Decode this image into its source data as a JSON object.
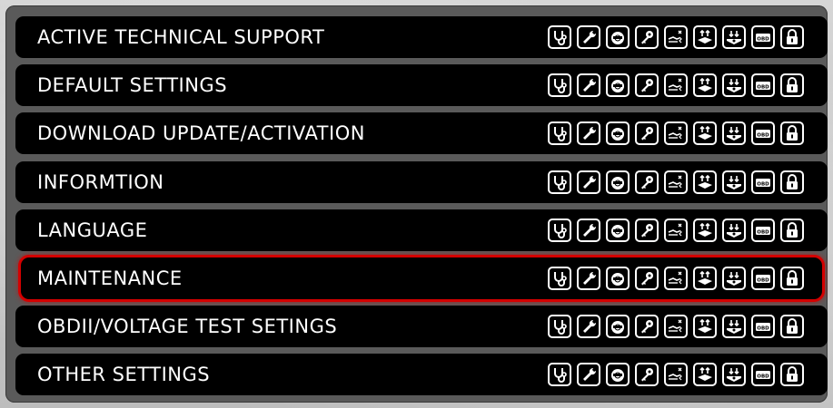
{
  "menu": {
    "items": [
      {
        "label": "ACTIVE TECHNICAL SUPPORT",
        "selected": false
      },
      {
        "label": "DEFAULT SETTINGS",
        "selected": false
      },
      {
        "label": "DOWNLOAD UPDATE/ACTIVATION",
        "selected": false
      },
      {
        "label": "INFORMTION",
        "selected": false
      },
      {
        "label": "LANGUAGE",
        "selected": false
      },
      {
        "label": "MAINTENANCE",
        "selected": true
      },
      {
        "label": "OBDII/VOLTAGE TEST SETINGS",
        "selected": false
      },
      {
        "label": "OTHER SETTINGS",
        "selected": false
      }
    ],
    "row_icons": [
      "stethoscope-icon",
      "wrench-icon",
      "gauge-icon",
      "key-icon",
      "hand-crash-icon",
      "upload-arrows-icon",
      "download-arrows-icon",
      "obd-engine-icon",
      "padlock-icon"
    ],
    "obd_text": "OBD"
  },
  "colors": {
    "background": "#c9c9c9",
    "panel": "#5a5a5a",
    "row": "#000000",
    "text": "#ffffff",
    "selected_border": "#d40000"
  }
}
